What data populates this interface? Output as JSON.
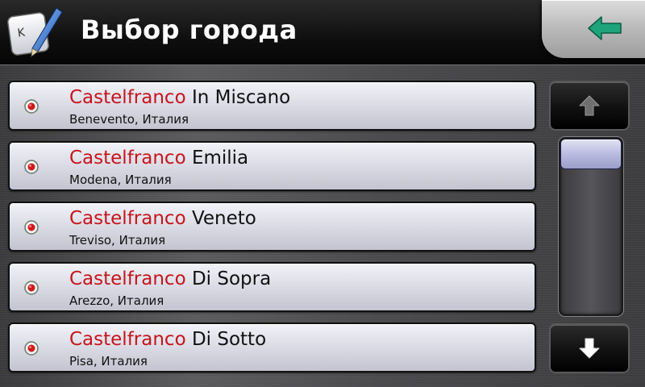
{
  "header": {
    "title": "Выбор города",
    "app_icon_letter": "K",
    "app_icon": "keyboard-pen-icon",
    "back_icon": "arrow-left-icon"
  },
  "cities": [
    {
      "prefix": "Castelfranco",
      "suffix": " In Miscano",
      "region": "Benevento, Италия"
    },
    {
      "prefix": "Castelfranco",
      "suffix": " Emilia",
      "region": "Modena, Италия"
    },
    {
      "prefix": "Castelfranco",
      "suffix": " Veneto",
      "region": "Treviso, Италия"
    },
    {
      "prefix": "Castelfranco",
      "suffix": " Di Sopra",
      "region": "Arezzo, Италия"
    },
    {
      "prefix": "Castelfranco",
      "suffix": " Di Sotto",
      "region": "Pisa, Италия"
    }
  ],
  "scroll": {
    "up_icon": "arrow-up-icon",
    "down_icon": "arrow-down-icon",
    "position_fraction": 0
  },
  "colors": {
    "match_highlight": "#c8141c",
    "back_arrow": "#1fa37a"
  }
}
